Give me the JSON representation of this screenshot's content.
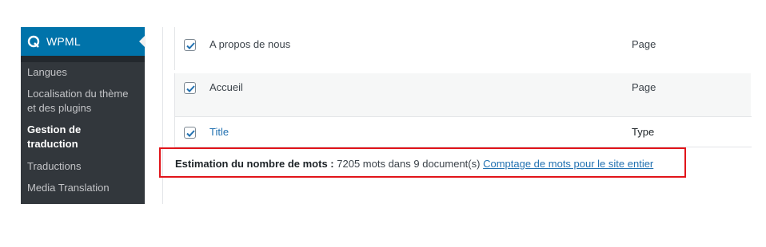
{
  "sidebar": {
    "header": {
      "icon": "wpml-logo-icon",
      "label": "WPML"
    },
    "items": [
      {
        "label": "Langues",
        "current": false
      },
      {
        "label": "Localisation du thème",
        "label2": "et des plugins",
        "current": false
      },
      {
        "label": "Gestion de",
        "label2": "traduction",
        "current": true
      },
      {
        "label": "Traductions",
        "current": false
      },
      {
        "label": "Media Translation",
        "current": false
      }
    ]
  },
  "table": {
    "rows": [
      {
        "checked": true,
        "title": "A propos de nous",
        "type": "Page"
      },
      {
        "checked": true,
        "title": "Accueil",
        "type": "Page"
      }
    ],
    "footer": {
      "checked": true,
      "title": "Title",
      "type": "Type"
    }
  },
  "wordcount": {
    "label": "Estimation du nombre de mots :",
    "value": "7205 mots dans 9 document(s)",
    "link": "Comptage de mots pour le site entier"
  },
  "colors": {
    "sidebar_bg": "#23282d",
    "submenu_bg": "#32373c",
    "accent": "#0073aa",
    "highlight": "#e1141a",
    "link": "#2271b1"
  }
}
